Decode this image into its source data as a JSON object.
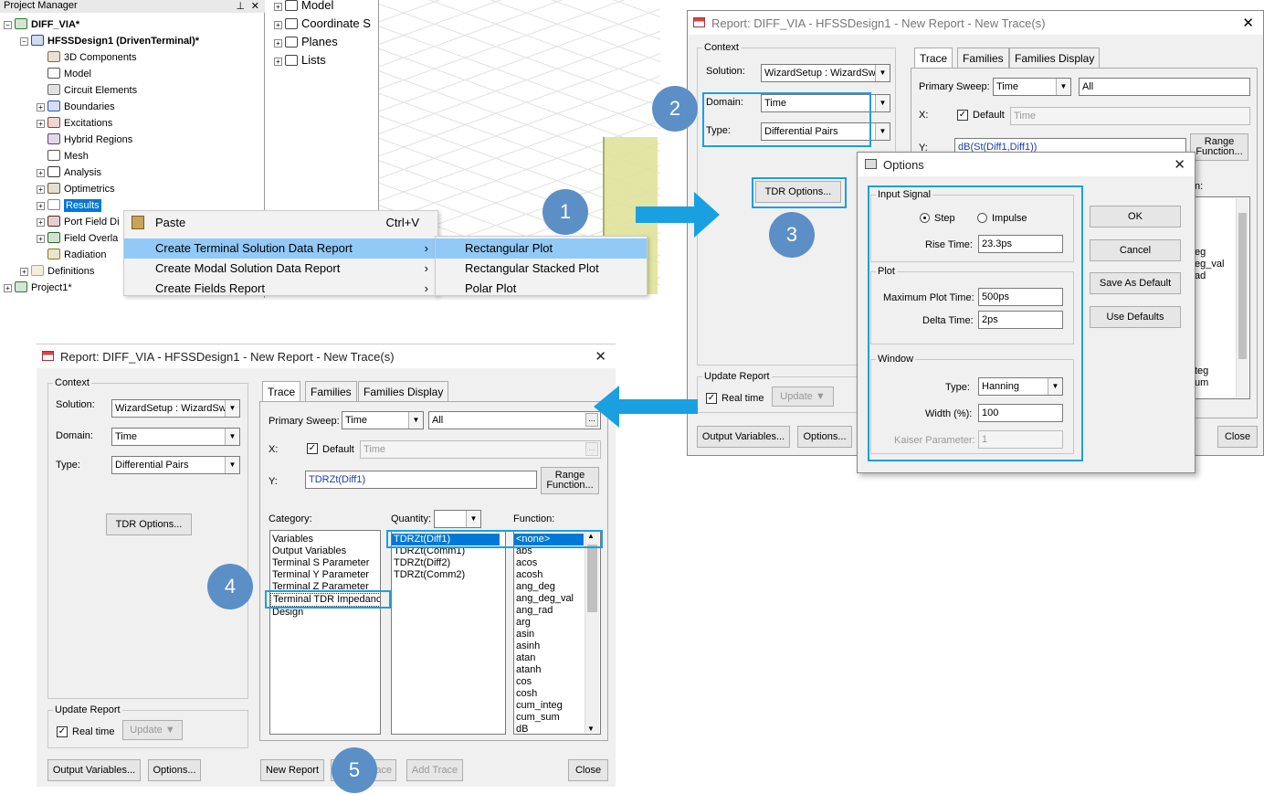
{
  "project_manager": {
    "title": "Project Manager",
    "tree": [
      {
        "label": "DIFF_VIA*",
        "depth": 0,
        "bold": true
      },
      {
        "label": "HFSSDesign1 (DrivenTerminal)*",
        "depth": 1,
        "bold": true
      },
      {
        "label": "3D Components",
        "depth": 2
      },
      {
        "label": "Model",
        "depth": 2
      },
      {
        "label": "Circuit Elements",
        "depth": 2
      },
      {
        "label": "Boundaries",
        "depth": 2
      },
      {
        "label": "Excitations",
        "depth": 2
      },
      {
        "label": "Hybrid Regions",
        "depth": 2
      },
      {
        "label": "Mesh",
        "depth": 2
      },
      {
        "label": "Analysis",
        "depth": 2
      },
      {
        "label": "Optimetrics",
        "depth": 2
      },
      {
        "label": "Results",
        "depth": 2,
        "selected": true
      },
      {
        "label": "Port Field Di",
        "depth": 2
      },
      {
        "label": "Field Overla",
        "depth": 2
      },
      {
        "label": "Radiation",
        "depth": 2
      },
      {
        "label": "Definitions",
        "depth": 1
      },
      {
        "label": "Project1*",
        "depth": 0
      }
    ]
  },
  "model_tree": [
    "Model",
    "Coordinate S",
    "Planes",
    "Lists"
  ],
  "context_menu": {
    "items": [
      {
        "label": "Paste",
        "shortcut": "Ctrl+V"
      },
      {
        "label": "Create Terminal Solution Data Report",
        "arrow": "›"
      },
      {
        "label": "Create Modal Solution Data Report",
        "arrow": "›"
      },
      {
        "label": "Create Fields Report",
        "arrow": "›"
      }
    ],
    "submenu": [
      "Rectangular Plot",
      "Rectangular Stacked Plot",
      "Polar Plot"
    ]
  },
  "report_top": {
    "title": "Report: DIFF_VIA - HFSSDesign1 - New Report - New Trace(s)",
    "context": "Context",
    "solution_label": "Solution:",
    "solution_value": "WizardSetup : WizardSwe",
    "domain_label": "Domain:",
    "domain_value": "Time",
    "type_label": "Type:",
    "type_value": "Differential Pairs",
    "tdr_button": "TDR Options...",
    "tabs": [
      "Trace",
      "Families",
      "Families Display"
    ],
    "primary_sweep_label": "Primary Sweep:",
    "primary_sweep_value": "Time",
    "all_value": "All",
    "x_label": "X:",
    "default_label": "Default",
    "x_value": "Time",
    "y_label": "Y:",
    "y_value": "dB(St(Diff1,Diff1))",
    "range_function": "Range Function...",
    "update_report": "Update Report",
    "real_time": "Real time",
    "update": "Update",
    "output_variables": "Output Variables...",
    "options": "Options...",
    "close": "Close",
    "func_partial": [
      "eg",
      "eg_val",
      "ad",
      "teg",
      "um"
    ],
    "function_label_partial": "n:"
  },
  "options_dialog": {
    "title": "Options",
    "input_signal": "Input Signal",
    "step": "Step",
    "impulse": "Impulse",
    "rise_time_label": "Rise Time:",
    "rise_time_value": "23.3ps",
    "plot": "Plot",
    "max_plot_time_label": "Maximum Plot Time:",
    "max_plot_time_value": "500ps",
    "delta_time_label": "Delta Time:",
    "delta_time_value": "2ps",
    "window": "Window",
    "type_label": "Type:",
    "type_value": "Hanning",
    "width_label": "Width (%):",
    "width_value": "100",
    "kaiser_label": "Kaiser Parameter:",
    "kaiser_value": "1",
    "ok": "OK",
    "cancel": "Cancel",
    "save_default": "Save As Default",
    "use_defaults": "Use Defaults"
  },
  "report_bottom": {
    "title": "Report: DIFF_VIA - HFSSDesign1 - New Report - New Trace(s)",
    "context": "Context",
    "solution_label": "Solution:",
    "solution_value": "WizardSetup : WizardSwe",
    "domain_label": "Domain:",
    "domain_value": "Time",
    "type_label": "Type:",
    "type_value": "Differential Pairs",
    "tdr_button": "TDR Options...",
    "tabs": [
      "Trace",
      "Families",
      "Families Display"
    ],
    "primary_sweep_label": "Primary Sweep:",
    "primary_sweep_value": "Time",
    "all_value": "All",
    "x_label": "X:",
    "default_label": "Default",
    "x_value": "Time",
    "y_label": "Y:",
    "y_value": "TDRZt(Diff1)",
    "range_function": "Range Function...",
    "category_label": "Category:",
    "quantity_label": "Quantity:",
    "function_label": "Function:",
    "categories": [
      "Variables",
      "Output Variables",
      "Terminal S Parameter",
      "Terminal Y Parameter",
      "Terminal Z Parameter",
      "Terminal TDR Impedance",
      "Design"
    ],
    "quantities": [
      "TDRZt(Diff1)",
      "TDRZt(Comm1)",
      "TDRZt(Diff2)",
      "TDRZt(Comm2)"
    ],
    "functions": [
      "<none>",
      "abs",
      "acos",
      "acosh",
      "ang_deg",
      "ang_deg_val",
      "ang_rad",
      "arg",
      "asin",
      "asinh",
      "atan",
      "atanh",
      "cos",
      "cosh",
      "cum_integ",
      "cum_sum",
      "dB"
    ],
    "update_report": "Update Report",
    "real_time": "Real time",
    "update": "Update",
    "output_variables": "Output Variables...",
    "options": "Options...",
    "new_report": "New Report",
    "apply_trace_partial": "ace",
    "add_trace": "Add Trace",
    "close": "Close"
  },
  "steps": [
    "1",
    "2",
    "3",
    "4",
    "5"
  ],
  "colors": {
    "highlight": "#1aa0e0",
    "circle": "#5b8fc6",
    "selection": "#0078d7",
    "menu_active": "#91c9f7"
  }
}
